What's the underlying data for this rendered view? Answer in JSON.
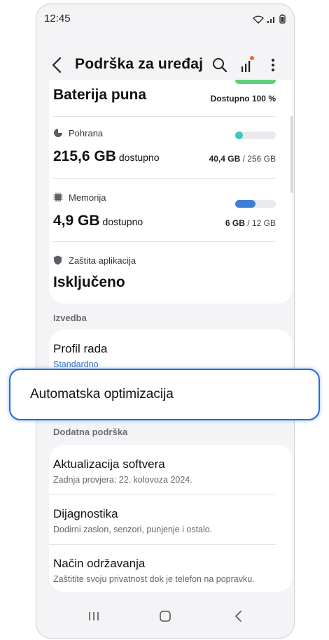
{
  "status": {
    "time": "12:45",
    "icons": [
      "wifi-icon",
      "signal-icon",
      "battery-icon"
    ]
  },
  "appbar": {
    "title": "Podrška za uređaj",
    "icons": [
      "back-arrow-icon",
      "search-icon",
      "diagnostics-bars-icon",
      "more-vertical-icon"
    ]
  },
  "battery": {
    "label": "Baterija puna",
    "available": "Dostupno 100 %",
    "progress": 1.0
  },
  "storage": {
    "label": "Pohrana",
    "value": "215,6 GB",
    "unit": "dostupno",
    "used": "40,4 GB",
    "total": "256 GB",
    "separator": "/",
    "progress": 0.16,
    "color": "#3fc8bf"
  },
  "memory": {
    "label": "Memorija",
    "value": "4,9 GB",
    "unit": "dostupno",
    "used": "6 GB",
    "total": "12 GB",
    "separator": "/",
    "progress": 0.5,
    "color": "#3e7fd6"
  },
  "app_protection": {
    "label": "Zaštita aplikacija",
    "value": "Isključeno"
  },
  "performance": {
    "section": "Izvedba",
    "profile_title": "Profil rada",
    "profile_value": "Standardno"
  },
  "highlight": {
    "label": "Automatska optimizacija"
  },
  "additional": {
    "section": "Dodatna podrška",
    "items": [
      {
        "title": "Aktualizacija softvera",
        "subtitle": "Zadnja provjera: 22. kolovoza 2024."
      },
      {
        "title": "Dijagnostika",
        "subtitle": "Dodirni zaslon, senzori, punjenje i ostalo."
      },
      {
        "title": "Način održavanja",
        "subtitle": "Zaštitite svoju privatnost dok je telefon na popravku."
      }
    ]
  },
  "colors": {
    "accent": "#1e6fe0",
    "battery_green": "#5fd07a",
    "notification_dot": "#f06a2a"
  }
}
